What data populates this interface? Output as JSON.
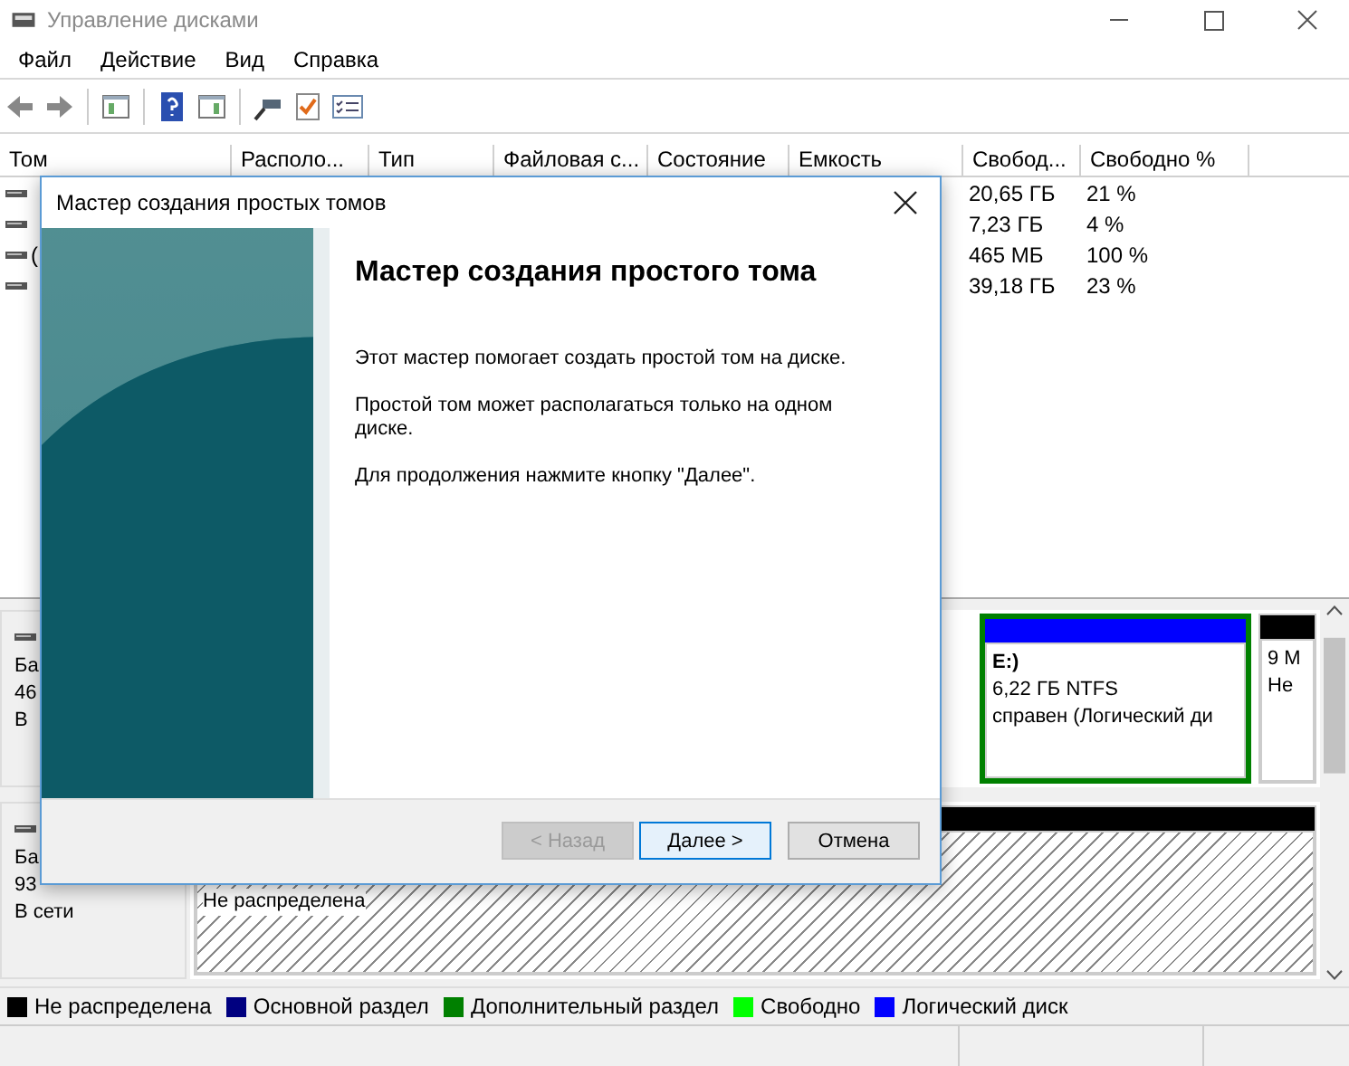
{
  "window": {
    "title": "Управление дисками"
  },
  "menu": [
    {
      "label": "Файл"
    },
    {
      "label": "Действие"
    },
    {
      "label": "Вид"
    },
    {
      "label": "Справка"
    }
  ],
  "table": {
    "columns": [
      "Том",
      "Располо...",
      "Тип",
      "Файловая с...",
      "Состояние",
      "Емкость",
      "Свобод...",
      "Свободно %"
    ],
    "rows": [
      {
        "free": "20,65 ГБ",
        "free_pct": "21 %"
      },
      {
        "free": "7,23 ГБ",
        "free_pct": "4 %"
      },
      {
        "volume": "(",
        "free": "465 МБ",
        "free_pct": "100 %"
      },
      {
        "free": "39,18 ГБ",
        "free_pct": "23 %"
      }
    ]
  },
  "disks": [
    {
      "label_lines": [
        "Ба",
        "46",
        "В"
      ],
      "partitions": [
        {
          "kind": "logical",
          "lines": [
            "Е:)",
            "6,22 ГБ NTFS",
            "справен (Логический ди"
          ]
        },
        {
          "kind": "unallocated",
          "lines": [
            "9 М",
            "Не"
          ]
        }
      ]
    },
    {
      "label_lines": [
        "Ба",
        "93",
        "В сети"
      ],
      "partitions": [
        {
          "kind": "unallocated_wide",
          "lines": [
            "Не распределена"
          ]
        }
      ]
    }
  ],
  "legend": [
    {
      "label": "Не распределена",
      "color": "#000000"
    },
    {
      "label": "Основной раздел",
      "color": "#000080"
    },
    {
      "label": "Дополнительный раздел",
      "color": "#008000"
    },
    {
      "label": "Свободно",
      "color": "#00ff00"
    },
    {
      "label": "Логический диск",
      "color": "#0000ff"
    }
  ],
  "dialog": {
    "title": "Мастер создания простых томов",
    "heading": "Мастер создания простого тома",
    "paragraphs": [
      "Этот мастер помогает создать простой том на диске.",
      "Простой том может располагаться только на одном диске.",
      "Для продолжения нажмите кнопку \"Далее\"."
    ],
    "buttons": [
      {
        "label": "< Назад",
        "disabled": true,
        "default": false
      },
      {
        "label": "Далее >",
        "disabled": false,
        "default": true
      },
      {
        "label": "Отмена",
        "disabled": false,
        "default": false
      }
    ]
  }
}
